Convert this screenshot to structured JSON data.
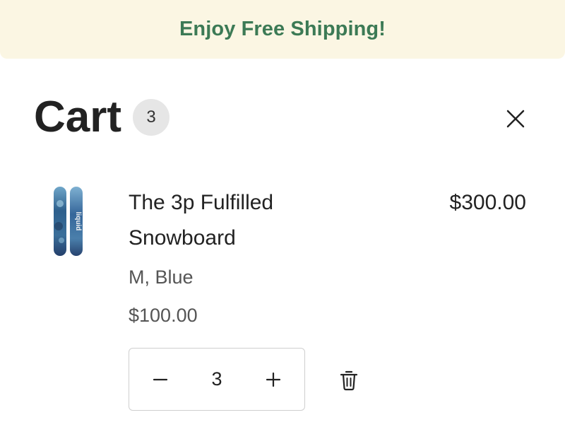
{
  "banner": {
    "text": "Enjoy Free Shipping!"
  },
  "cart": {
    "title": "Cart",
    "count": "3"
  },
  "item": {
    "title": "The 3p Fulfilled Snowboard",
    "line_price": "$300.00",
    "variant": "M, Blue",
    "unit_price": "$100.00",
    "quantity": "3",
    "image_label": "liquid"
  },
  "icons": {
    "close": "close-icon",
    "minus": "minus-icon",
    "plus": "plus-icon",
    "trash": "trash-icon"
  },
  "colors": {
    "banner_bg": "#fbf6e3",
    "banner_text": "#3c7a55",
    "count_badge_bg": "#e6e6e6"
  }
}
